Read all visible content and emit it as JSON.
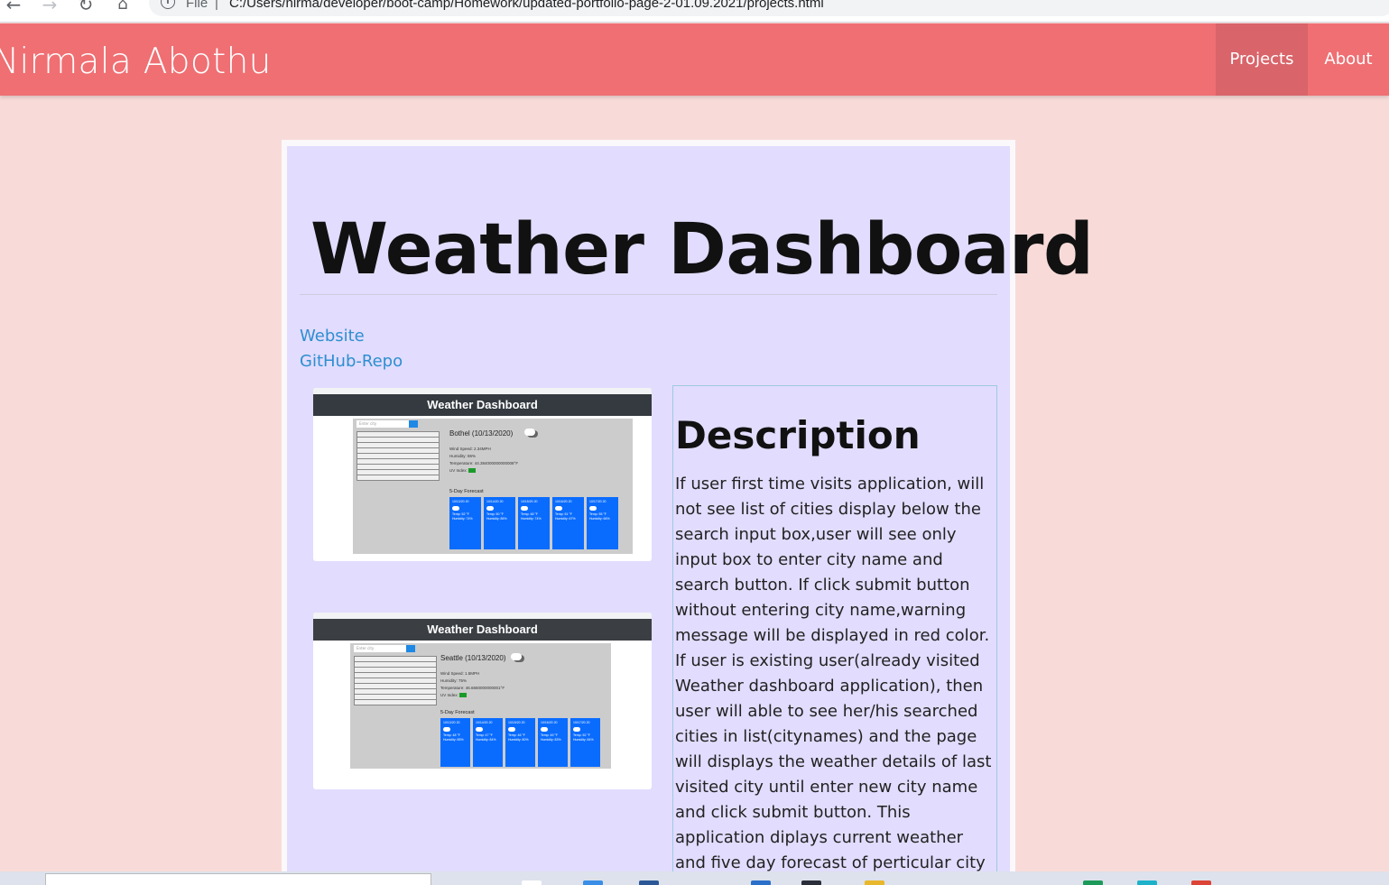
{
  "browser": {
    "file_label": "File",
    "url": "C:/Users/nirma/developer/boot-camp/Homework/updated-portfolio-page-2-01.09.2021/projects.html",
    "info_icon": "info-icon"
  },
  "navbar": {
    "brand": "Nirmala Abothu",
    "links": [
      {
        "label": "Projects",
        "active": true
      },
      {
        "label": "About",
        "active": false
      }
    ],
    "colors": {
      "bar": "#ef6f73",
      "active": "#d9646a"
    }
  },
  "project": {
    "title": "Weather Dashboard",
    "links": {
      "website": "Website",
      "github": "GitHub-Repo"
    },
    "screenshots": [
      {
        "header": "Weather Dashboard",
        "search_placeholder": "Enter city",
        "city": "Bothel (10/13/2020)",
        "details": [
          "Wind Speed: 2.34MPH",
          "Humidity: 86%",
          "Temperature: 44.384000000000008°F",
          "UV Index:"
        ],
        "forecast_title": "5-Day Forecast",
        "forecast": [
          {
            "date": "10/13/20 20",
            "temp": "Temp: 52 °F",
            "humidity": "Humidity: 74%"
          },
          {
            "date": "10/14/20 20",
            "temp": "Temp: 50 °F",
            "humidity": "Humidity: 86%"
          },
          {
            "date": "10/15/20 20",
            "temp": "Temp: 48 °F",
            "humidity": "Humidity: 74%"
          },
          {
            "date": "10/16/20 20",
            "temp": "Temp: 51 °F",
            "humidity": "Humidity: 67%"
          },
          {
            "date": "10/17/20 20",
            "temp": "Temp: 55 °F",
            "humidity": "Humidity: 66%"
          }
        ]
      },
      {
        "header": "Weather Dashboard",
        "search_placeholder": "Enter city",
        "city": "Seattle (10/13/2020)",
        "details": [
          "Wind Speed: 1.5MPH",
          "Humidity: 75%",
          "Temperature: 46.6660000000001°F",
          "UV Index:"
        ],
        "forecast_title": "5-Day Forecast",
        "forecast": [
          {
            "date": "10/13/20 20",
            "temp": "Temp: 48 °F",
            "humidity": "Humidity: 85%"
          },
          {
            "date": "10/14/20 20",
            "temp": "Temp: 47 °F",
            "humidity": "Humidity: 84%"
          },
          {
            "date": "10/15/20 20",
            "temp": "Temp: 46 °F",
            "humidity": "Humidity: 80%"
          },
          {
            "date": "10/16/20 20",
            "temp": "Temp: 49 °F",
            "humidity": "Humidity: 83%"
          },
          {
            "date": "10/17/20 20",
            "temp": "Temp: 52 °F",
            "humidity": "Humidity: 84%"
          }
        ]
      }
    ],
    "description_title": "Description",
    "description": "If user first time visits application, will not see list of cities display below the search input box,user will see only input box to enter city name and search button. If click submit button without entering city name,warning message will be displayed in red color. If user is existing user(already visited Weather dashboard application), then user will able to see her/his searched cities in list(citynames) and the page will displays the weather details of last visited city until enter new city name and click submit button. This application diplays current weather and five day forecast of perticular city selected by user. Current weather details will be retrived thru"
  },
  "colors": {
    "page_bg": "#f8dbd9",
    "card_bg": "#e2dcfe",
    "link": "#2d8fd0"
  }
}
